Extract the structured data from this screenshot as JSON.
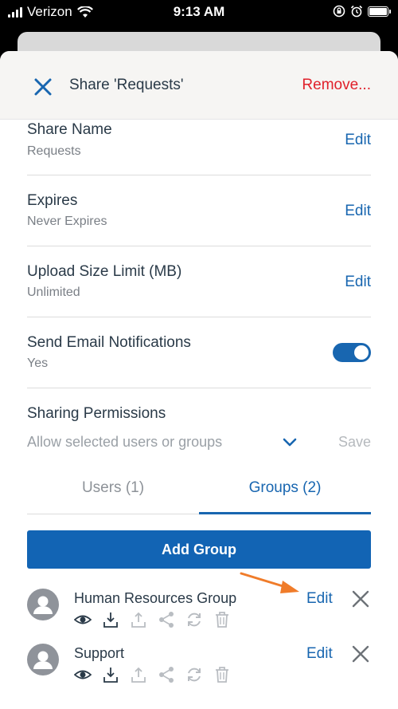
{
  "status_bar": {
    "carrier": "Verizon",
    "time": "9:13 AM"
  },
  "header": {
    "title": "Share 'Requests'",
    "remove_label": "Remove..."
  },
  "settings": [
    {
      "title": "Share Name",
      "value": "Requests",
      "action": "Edit"
    },
    {
      "title": "Expires",
      "value": "Never Expires",
      "action": "Edit"
    },
    {
      "title": "Upload Size Limit (MB)",
      "value": "Unlimited",
      "action": "Edit"
    }
  ],
  "notifications": {
    "title": "Send Email Notifications",
    "value": "Yes",
    "enabled": true
  },
  "permissions": {
    "title": "Sharing Permissions",
    "selected": "Allow selected users or groups",
    "save_label": "Save"
  },
  "tabs": {
    "users": "Users (1)",
    "groups": "Groups (2)",
    "active": "groups"
  },
  "add_group_label": "Add Group",
  "groups": [
    {
      "name": "Human Resources Group",
      "action": "Edit"
    },
    {
      "name": "Support",
      "action": "Edit"
    }
  ],
  "colors": {
    "accent": "#1866b0",
    "danger": "#e0212b",
    "annotation_arrow": "#f07c2a"
  }
}
